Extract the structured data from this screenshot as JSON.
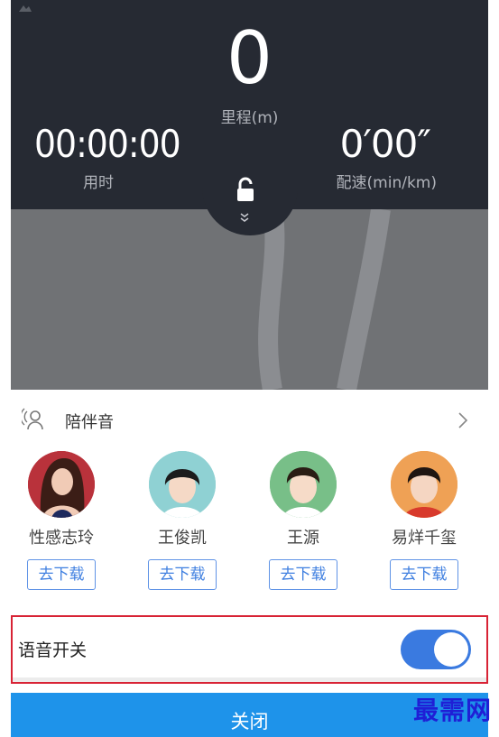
{
  "stats": {
    "distance_value": "0",
    "distance_label": "里程(m)",
    "time_value": "00:00:00",
    "time_label": "用时",
    "pace_value": "0′00″",
    "pace_label": "配速(min/km)"
  },
  "companion": {
    "title": "陪伴音",
    "voices": [
      {
        "name": "性感志玲",
        "action": "去下载"
      },
      {
        "name": "王俊凯",
        "action": "去下载"
      },
      {
        "name": "王源",
        "action": "去下载"
      },
      {
        "name": "易烊千玺",
        "action": "去下载"
      }
    ]
  },
  "voice_switch": {
    "label": "语音开关",
    "on": true
  },
  "close_label": "关闭",
  "watermark": "最需网",
  "colors": {
    "header": "#262a33",
    "accent": "#3a7ae0",
    "close": "#1e93ea",
    "highlight": "#d82335"
  },
  "icons": [
    "lock-icon",
    "chevron-down-icon",
    "companion-voice-icon",
    "chevron-right-icon"
  ]
}
